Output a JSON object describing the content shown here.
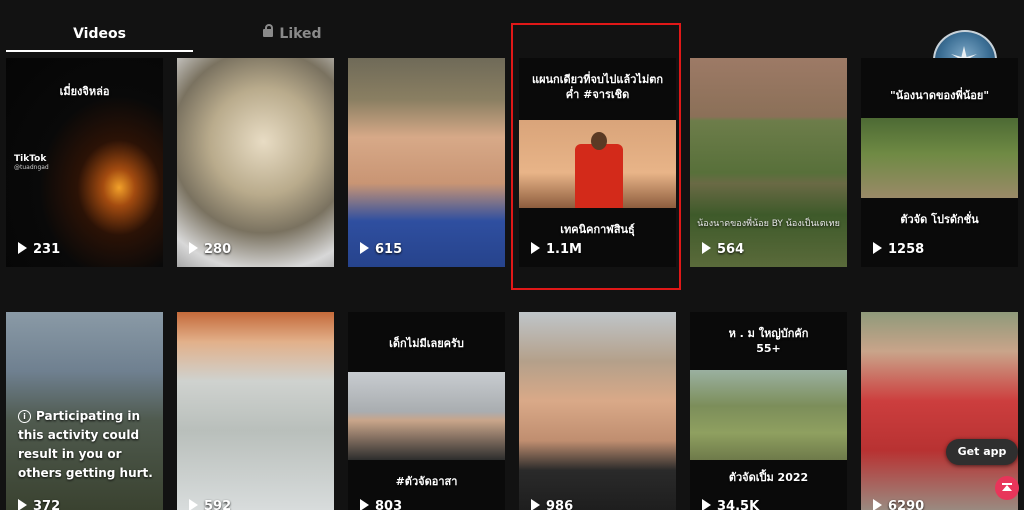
{
  "tabs": {
    "videos": "Videos",
    "liked": "Liked"
  },
  "row1": [
    {
      "caption": "เมี่ยงจิหล่อ",
      "views": "231",
      "watermark": "TikTok",
      "watermark_user": "@tuadngad"
    },
    {
      "caption": "",
      "views": "280"
    },
    {
      "caption": "",
      "views": "615"
    },
    {
      "caption": "แผนกเดียวที่จบไปแล้วไม่ตกค่ำ #จารเชิด",
      "subcaption": "เทคนิคกาฬสินธุ์",
      "views": "1.1M"
    },
    {
      "caption": "",
      "bottom": "น้องนาดของพี่น้อย BY น้องเป็นเตเทย",
      "views": "564"
    },
    {
      "caption": "\"น้องนาดของพี่น้อย\"",
      "subcaption": "ตัวจัด โปรดักชั่น",
      "views": "1258"
    }
  ],
  "row2": [
    {
      "warning": "Participating in this activity could result in you or others getting hurt.",
      "views": "372"
    },
    {
      "caption": "",
      "views": "592"
    },
    {
      "caption": "เด็กไม่มีเลยครับ",
      "bottom": "#ตัวจัดอาสา",
      "views": "803"
    },
    {
      "caption": "",
      "views": "986"
    },
    {
      "caption": "ห . ม ใหญ่บักคัก 55+",
      "bottom": "ตัวจัดเปิ้ม 2022",
      "views": "34.5K"
    },
    {
      "caption": "",
      "views": "6290"
    }
  ],
  "buttons": {
    "get_app": "Get app"
  },
  "colors": {
    "background": "#121212",
    "highlight": "#e01818",
    "accent": "#e8355a"
  }
}
